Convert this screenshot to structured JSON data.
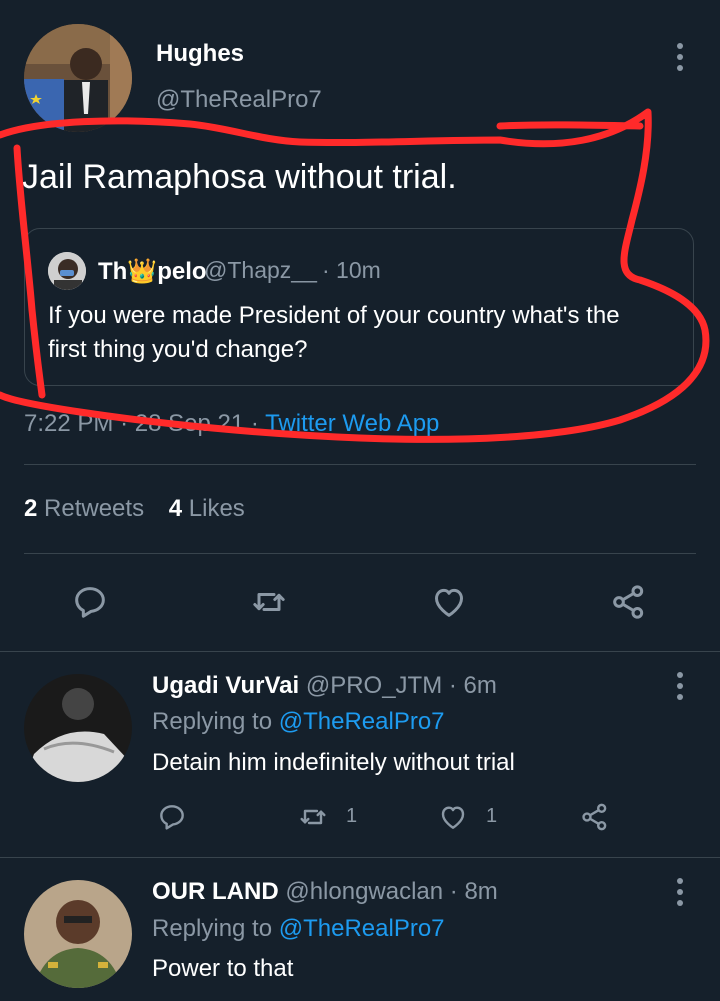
{
  "tweet": {
    "name": "Hughes",
    "handle": "@TheRealPro7",
    "text": "Jail Ramaphosa without trial.",
    "meta_time": "7:22 PM",
    "meta_sep1": "·",
    "meta_date": "28 Sep 21",
    "meta_sep2": "·",
    "meta_source": "Twitter Web App",
    "quote": {
      "name": "Th👑pelo",
      "handle": "@Thapz__",
      "time": "· 10m",
      "text_line1": "If you were made President of your country what's the",
      "text_line2": "first thing you'd change?"
    },
    "stats": {
      "retweets_count": "2",
      "retweets_label": "Retweets",
      "likes_count": "4",
      "likes_label": "Likes"
    },
    "actions": [
      "reply-icon",
      "retweet-icon",
      "like-icon",
      "share-icon"
    ]
  },
  "replies": [
    {
      "name": "Ugadi VurVai",
      "handle": "@PRO_JTM",
      "time": "· 6m",
      "replying_prefix": "Replying to",
      "replying_handle": "@TheRealPro7",
      "text": "Detain him indefinitely without trial",
      "retweet_count": "1",
      "like_count": "1"
    },
    {
      "name": "OUR LAND",
      "handle": "@hlongwaclan",
      "time": "· 8m",
      "replying_prefix": "Replying to",
      "replying_handle": "@TheRealPro7",
      "text": "Power to that"
    }
  ],
  "colors": {
    "background": "#15202b",
    "muted": "#8b98a5",
    "link": "#1d9bf0",
    "annotation": "#ff2a2a"
  }
}
